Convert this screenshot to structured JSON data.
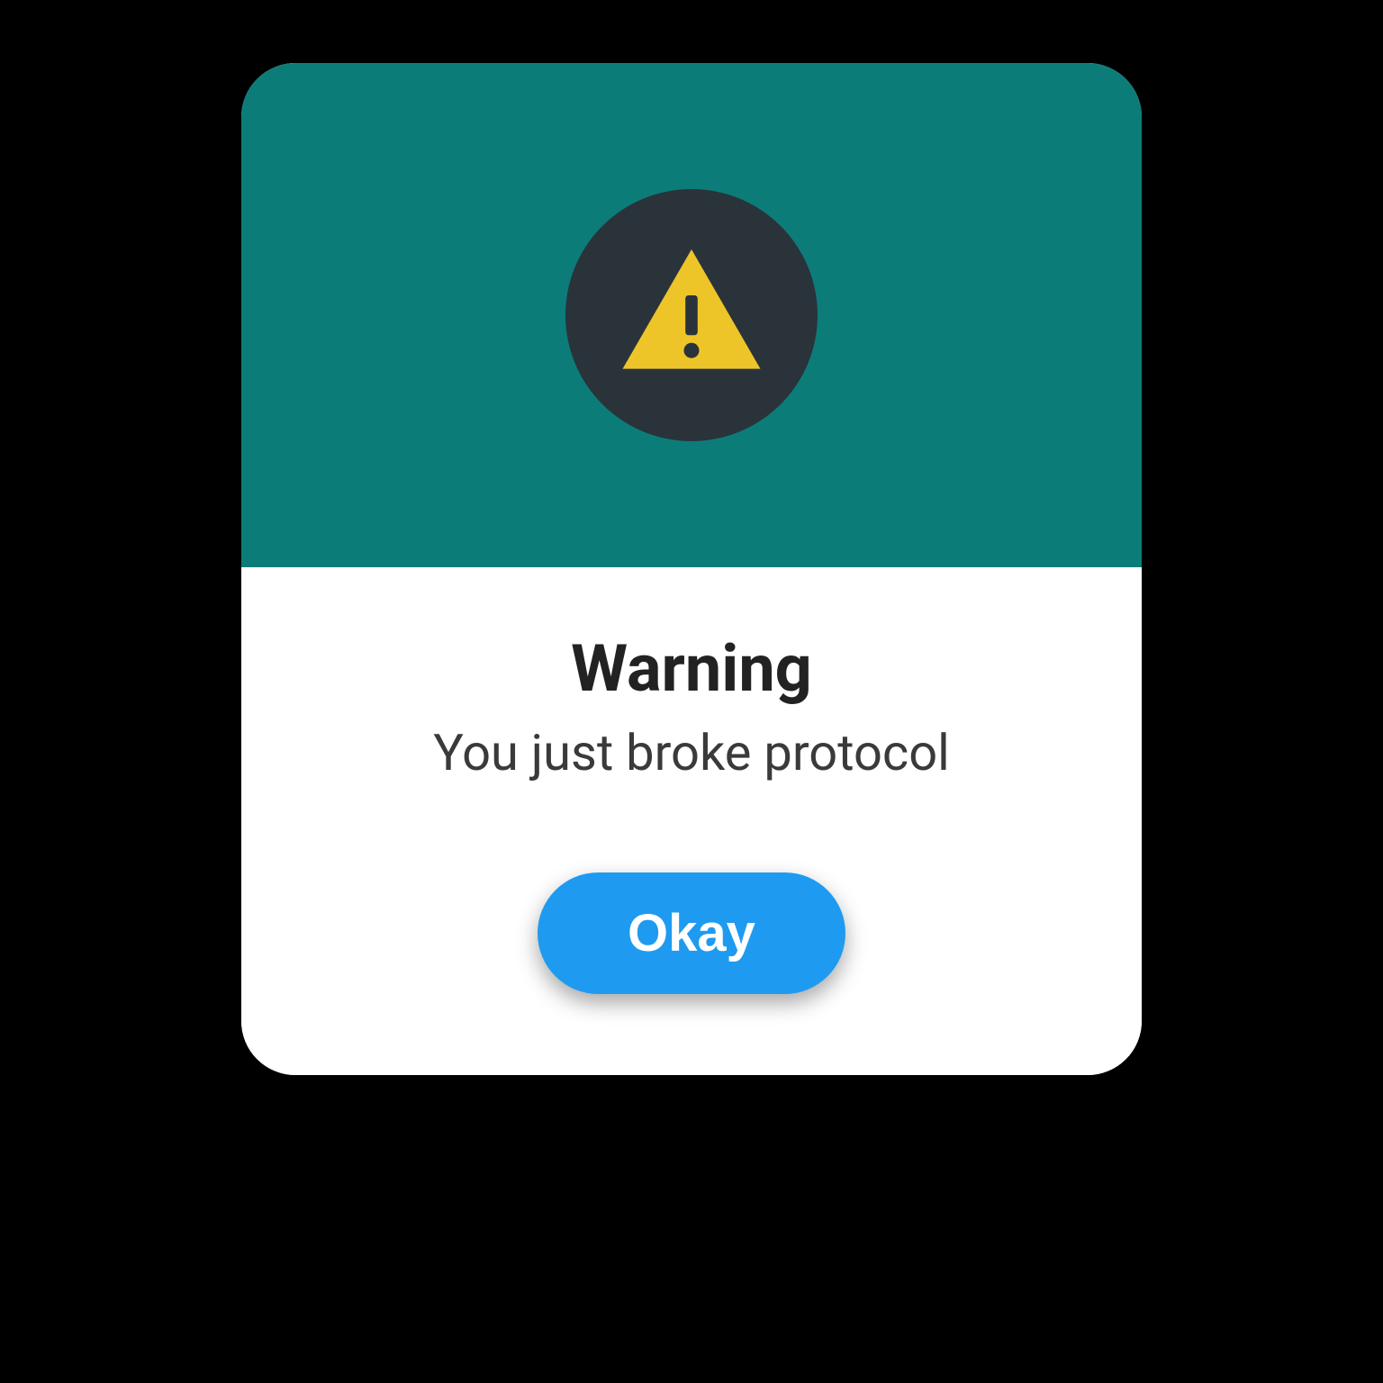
{
  "dialog": {
    "title": "Warning",
    "message": "You just broke protocol",
    "confirm_label": "Okay"
  },
  "colors": {
    "header_bg": "#0c7c79",
    "icon_circle_bg": "#2a333a",
    "warning_icon": "#eec529",
    "button_bg": "#1e9bf0",
    "button_text": "#ffffff"
  }
}
